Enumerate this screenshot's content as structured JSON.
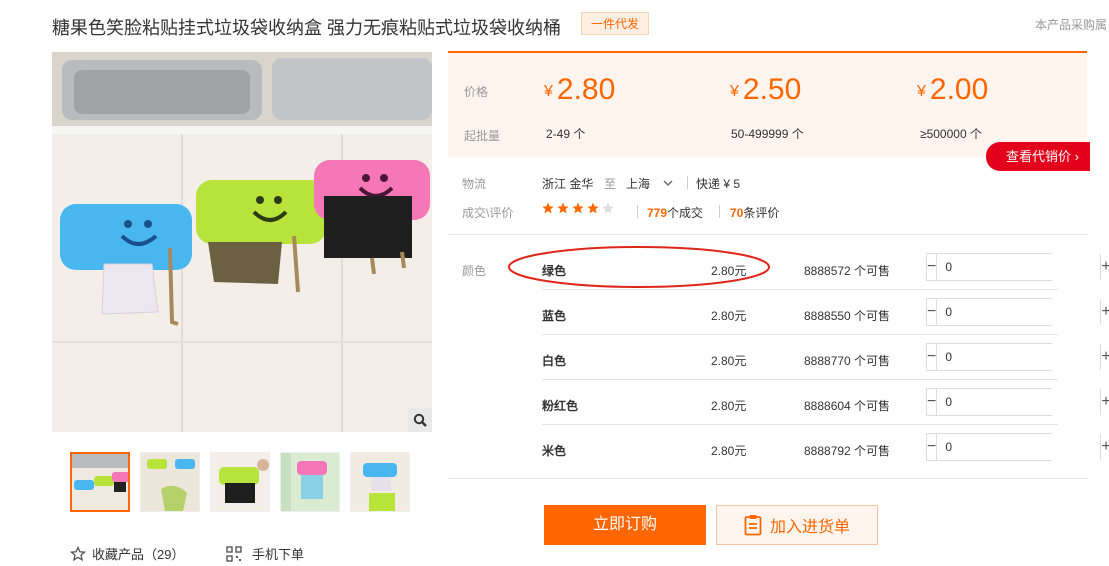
{
  "product": {
    "title": "糖果色笑脸粘贴挂式垃圾袋收纳盒 强力无痕粘贴式垃圾袋收纳桶",
    "badge": "一件代发",
    "purchase_note": "本产品采购属"
  },
  "gallery": {
    "thumbnail_count": 5,
    "favorite_label": "收藏产品（29）",
    "mobile_order_label": "手机下单"
  },
  "pricing": {
    "price_label": "价格",
    "moq_label": "起批量",
    "tiers": [
      {
        "currency": "¥",
        "price": "2.80",
        "moq": "2-49 个"
      },
      {
        "currency": "¥",
        "price": "2.50",
        "moq": "50-499999 个"
      },
      {
        "currency": "¥",
        "price": "2.00",
        "moq": "≥500000 个"
      }
    ],
    "agent_price_button": "查看代销价"
  },
  "logistics": {
    "label": "物流",
    "origin": "浙江 金华",
    "to": "至",
    "destination": "上海",
    "method": "快递 ¥ 5"
  },
  "reviews": {
    "label": "成交\\评价",
    "rating": 4.5,
    "deals_count": "779",
    "deals_unit": "个成交",
    "review_count": "70",
    "review_unit": "条评价"
  },
  "sku": {
    "label": "颜色",
    "items": [
      {
        "name": "绿色",
        "price": "2.80元",
        "stock": "8888572 个可售",
        "qty": "0",
        "circled": true
      },
      {
        "name": "蓝色",
        "price": "2.80元",
        "stock": "8888550 个可售",
        "qty": "0"
      },
      {
        "name": "白色",
        "price": "2.80元",
        "stock": "8888770 个可售",
        "qty": "0"
      },
      {
        "name": "粉红色",
        "price": "2.80元",
        "stock": "8888604 个可售",
        "qty": "0"
      },
      {
        "name": "米色",
        "price": "2.80元",
        "stock": "8888792 个可售",
        "qty": "0"
      }
    ]
  },
  "actions": {
    "buy_now": "立即订购",
    "add_to_list": "加入进货单"
  },
  "colors": {
    "accent": "#ff6600",
    "red": "#e4001b"
  }
}
